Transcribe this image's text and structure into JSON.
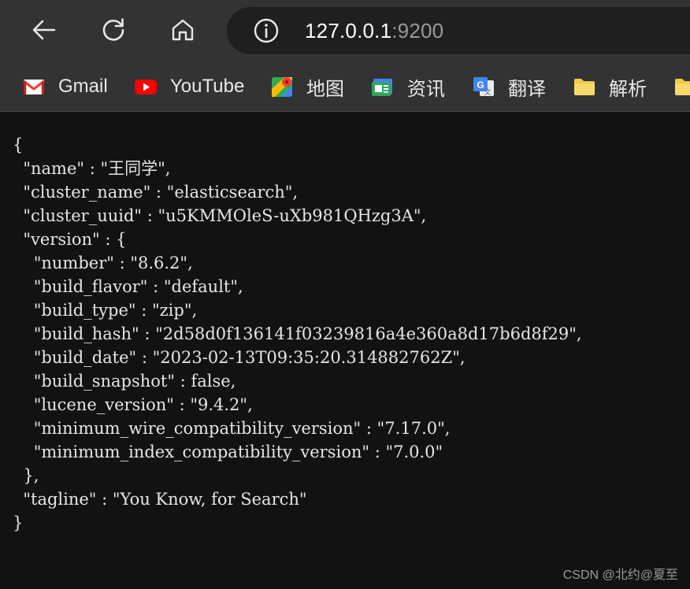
{
  "browser": {
    "address": {
      "host": "127.0.0.1",
      "port": ":9200"
    },
    "nav": {
      "back_icon": "arrow-left-icon",
      "reload_icon": "reload-icon",
      "home_icon": "home-icon",
      "info_icon": "info-icon"
    },
    "bookmarks": [
      {
        "label": "Gmail",
        "icon": "gmail-icon"
      },
      {
        "label": "YouTube",
        "icon": "youtube-icon"
      },
      {
        "label": "地图",
        "icon": "maps-icon"
      },
      {
        "label": "资讯",
        "icon": "news-icon"
      },
      {
        "label": "翻译",
        "icon": "translate-icon"
      },
      {
        "label": "解析",
        "icon": "folder-icon"
      },
      {
        "label": "",
        "icon": "folder-icon"
      }
    ]
  },
  "page": {
    "json_text": "{\n  \"name\" : \"王同学\",\n  \"cluster_name\" : \"elasticsearch\",\n  \"cluster_uuid\" : \"u5KMMOleS-uXb981QHzg3A\",\n  \"version\" : {\n    \"number\" : \"8.6.2\",\n    \"build_flavor\" : \"default\",\n    \"build_type\" : \"zip\",\n    \"build_hash\" : \"2d58d0f136141f03239816a4e360a8d17b6d8f29\",\n    \"build_date\" : \"2023-02-13T09:35:20.314882762Z\",\n    \"build_snapshot\" : false,\n    \"lucene_version\" : \"9.4.2\",\n    \"minimum_wire_compatibility_version\" : \"7.17.0\",\n    \"minimum_index_compatibility_version\" : \"7.0.0\"\n  },\n  \"tagline\" : \"You Know, for Search\"\n}",
    "watermark": "CSDN @北约@夏至"
  },
  "colors": {
    "toolbar_bg": "#333333",
    "address_bg": "#1f1f1f",
    "page_bg": "#121212",
    "text": "#e6e6e6"
  }
}
